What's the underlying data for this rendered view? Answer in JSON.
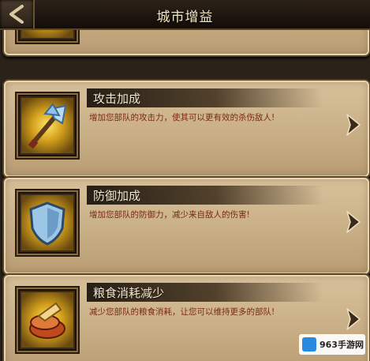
{
  "header": {
    "title": "城市增益"
  },
  "buffs": [
    {
      "name": "攻击加成",
      "description": "增加您部队的攻击力，使其可以更有效的杀伤敌人!",
      "icon": "axe-icon"
    },
    {
      "name": "防御加成",
      "description": "增加您部队的防御力，减少来自敌人的伤害!",
      "icon": "shield-icon"
    },
    {
      "name": "粮食消耗减少",
      "description": "减少您部队的粮食消耗，让您可以维持更多的部队!",
      "icon": "food-icon"
    }
  ],
  "watermark": {
    "text": "963手游网"
  },
  "colors": {
    "card": "#d9c29c",
    "desc_text": "#7a2a14",
    "title_text": "#f3e6c4"
  }
}
